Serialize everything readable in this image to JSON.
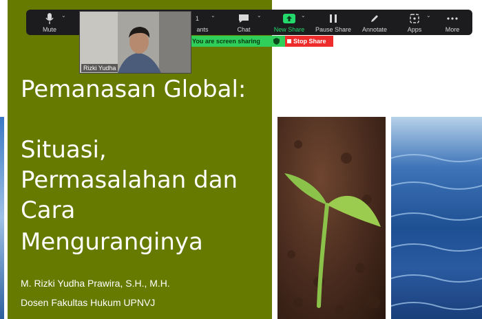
{
  "slide": {
    "title_line1": "Pemanasan Global:",
    "title_line2": "Situasi,",
    "title_line3": "Permasalahan dan",
    "title_line4": "Cara",
    "title_line5": "Menguranginya",
    "author": "M. Rizki Yudha Prawira, S.H., M.H.",
    "affiliation": "Dosen Fakultas Hukum UPNVJ",
    "colors": {
      "panel": "#667a00",
      "text": "#ffffff"
    }
  },
  "toolbar": {
    "mute": "Mute",
    "participants_count": "1",
    "participants": "ants",
    "chat": "Chat",
    "new_share": "New Share",
    "pause_share": "Pause Share",
    "annotate": "Annotate",
    "apps": "Apps",
    "more": "More",
    "icons": [
      "microphone-icon",
      "participants-icon",
      "chat-icon",
      "share-arrow-icon",
      "pause-icon",
      "pencil-icon",
      "apps-icon",
      "more-dots-icon"
    ],
    "colors": {
      "background": "#1c1c1e",
      "accent": "#23d96b"
    }
  },
  "share_bar": {
    "status": "You are screen sharing",
    "stop": "Stop Share",
    "colors": {
      "status": "#2fcf59",
      "stop": "#ee2c2c"
    }
  },
  "video": {
    "name": "Rizki Yudha"
  }
}
